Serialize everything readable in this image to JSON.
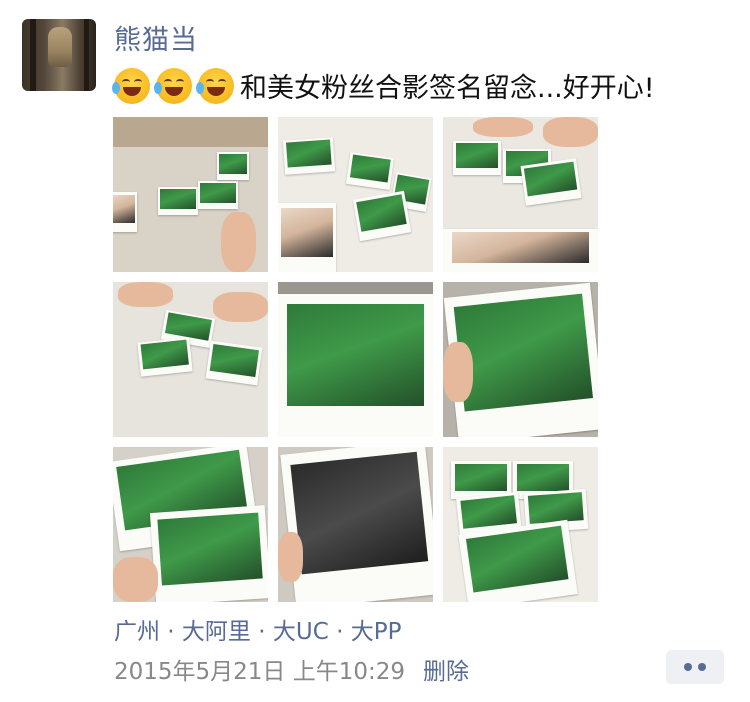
{
  "post": {
    "username": "熊猫当",
    "text": "和美女粉丝合影签名留念...好开心!",
    "emoji": [
      "laughing-with-tears-icon",
      "laughing-with-tears-icon",
      "laughing-with-tears-icon"
    ],
    "location": "广州 · 大阿里 · 大UC · 大PP",
    "timestamp": "2015年5月21日 上午10:29",
    "delete_label": "删除",
    "more_icon": "more-dots-icon"
  },
  "photos": [
    {
      "id": 1,
      "content": "autographed-photos-on-table"
    },
    {
      "id": 2,
      "content": "polaroids-spread-on-table"
    },
    {
      "id": 3,
      "content": "signing-polaroids"
    },
    {
      "id": 4,
      "content": "hands-with-polaroids"
    },
    {
      "id": 5,
      "content": "polaroid-with-fan"
    },
    {
      "id": 6,
      "content": "signed-polaroid-held-up"
    },
    {
      "id": 7,
      "content": "two-polaroids-held"
    },
    {
      "id": 8,
      "content": "signed-polaroid-group"
    },
    {
      "id": 9,
      "content": "many-polaroids-on-table"
    }
  ],
  "colors": {
    "link": "#576b95",
    "meta": "#888888",
    "text": "#111111"
  }
}
